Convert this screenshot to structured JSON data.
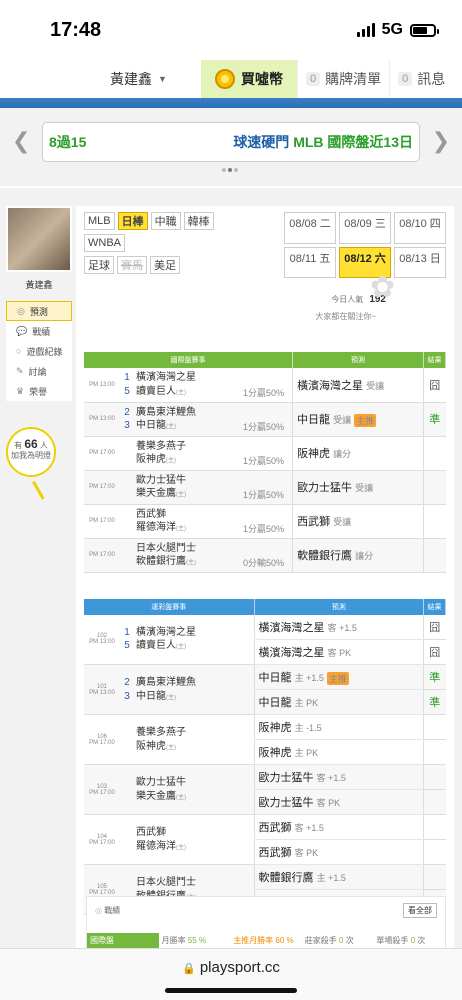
{
  "status": {
    "time": "17:48",
    "network": "5G"
  },
  "nav": {
    "user": "黃建鑫",
    "buy": "買噓幣",
    "cart_count": "0",
    "cart": "購牌清單",
    "msg_count": "0",
    "msg": "訊息"
  },
  "ticker": {
    "left": "8過15",
    "right_prefix": "球速硬門",
    "right_suffix": "MLB 國際盤近13日"
  },
  "sidebar": {
    "username": "黃建鑫",
    "items": [
      "預測",
      "戰績",
      "遊戲紀錄",
      "討論",
      "荣譽"
    ],
    "count_prefix": "有",
    "count": "66",
    "count_suffix": "人",
    "count_text": "加我為明燈"
  },
  "leagues": {
    "row1": [
      "MLB",
      "日棒",
      "中職",
      "韓棒"
    ],
    "row2": [
      "WNBA"
    ],
    "row3": [
      "足球",
      "賽馬",
      "美足"
    ]
  },
  "dates": [
    "08/08 二",
    "08/09 三",
    "08/10 四",
    "08/11 五",
    "08/12 六",
    "08/13 日"
  ],
  "popularity": {
    "label": "今日人氣",
    "value": "192",
    "note": "大家都在關注你~"
  },
  "intl": {
    "headers": [
      "國際盤賽事",
      "預測",
      "結果"
    ],
    "rows": [
      {
        "time": "PM 13:00",
        "n1": "1",
        "n2": "5",
        "t1": "橫濱海灣之星",
        "t2": "讀賣巨人",
        "odds": "1分贏50%",
        "pred": "橫濱海灣之星",
        "type": "受讓",
        "result": "囧",
        "tag": ""
      },
      {
        "time": "PM 13:00",
        "n1": "2",
        "n2": "3",
        "t1": "廣島東洋鯉魚",
        "t2": "中日龍",
        "odds": "1分贏50%",
        "pred": "中日龍",
        "type": "受讓",
        "result": "準",
        "tag": "主推"
      },
      {
        "time": "PM 17:00",
        "n1": "",
        "n2": "",
        "t1": "養樂多燕子",
        "t2": "阪神虎",
        "odds": "1分贏50%",
        "pred": "阪神虎",
        "type": "讓分",
        "result": "",
        "tag": ""
      },
      {
        "time": "PM 17:00",
        "n1": "",
        "n2": "",
        "t1": "歐力士猛牛",
        "t2": "樂天金鷹",
        "odds": "1分贏50%",
        "pred": "歐力士猛牛",
        "type": "受讓",
        "result": "",
        "tag": ""
      },
      {
        "time": "PM 17:00",
        "n1": "",
        "n2": "",
        "t1": "西武獅",
        "t2": "羅德海洋",
        "odds": "1分贏50%",
        "pred": "西武獅",
        "type": "受讓",
        "result": "",
        "tag": ""
      },
      {
        "time": "PM 17:00",
        "n1": "",
        "n2": "",
        "t1": "日本火腿鬥士",
        "t2": "軟體銀行鷹",
        "odds": "0分輸50%",
        "pred": "軟體銀行鷹",
        "type": "讓分",
        "result": "",
        "tag": ""
      }
    ]
  },
  "lottery": {
    "headers": [
      "運彩盤賽事",
      "預測",
      "結果"
    ],
    "rows": [
      {
        "id": "102",
        "time": "PM 13:00",
        "n1": "1",
        "n2": "5",
        "t1": "橫濱海灣之星",
        "t2": "讀賣巨人",
        "p1": "橫濱海灣之星",
        "p1t": "客 +1.5",
        "r1": "囧",
        "p2": "橫濱海灣之星",
        "p2t": "客 PK",
        "r2": "囧",
        "tag1": ""
      },
      {
        "id": "101",
        "time": "PM 13:00",
        "n1": "2",
        "n2": "3",
        "t1": "廣島東洋鯉魚",
        "t2": "中日龍",
        "p1": "中日龍",
        "p1t": "主 +1.5",
        "r1": "準",
        "p2": "中日龍",
        "p2t": "主 PK",
        "r2": "準",
        "tag1": "主推"
      },
      {
        "id": "106",
        "time": "PM 17:00",
        "n1": "",
        "n2": "",
        "t1": "養樂多燕子",
        "t2": "阪神虎",
        "p1": "阪神虎",
        "p1t": "主 -1.5",
        "r1": "",
        "p2": "阪神虎",
        "p2t": "主 PK",
        "r2": "",
        "tag1": ""
      },
      {
        "id": "103",
        "time": "PM 17:00",
        "n1": "",
        "n2": "",
        "t1": "歐力士猛牛",
        "t2": "樂天金鷹",
        "p1": "歐力士猛牛",
        "p1t": "客 +1.5",
        "r1": "",
        "p2": "歐力士猛牛",
        "p2t": "客 PK",
        "r2": "",
        "tag1": ""
      },
      {
        "id": "104",
        "time": "PM 17:00",
        "n1": "",
        "n2": "",
        "t1": "西武獅",
        "t2": "羅德海洋",
        "p1": "西武獅",
        "p1t": "客 +1.5",
        "r1": "",
        "p2": "西武獅",
        "p2t": "客 PK",
        "r2": "",
        "tag1": ""
      },
      {
        "id": "105",
        "time": "PM 17:00",
        "n1": "",
        "n2": "",
        "t1": "日本火腿鬥士",
        "t2": "軟體銀行鷹",
        "p1": "軟體銀行鷹",
        "p1t": "主 +1.5",
        "r1": "",
        "p2": "軟體銀行鷹",
        "p2t": "主 PK",
        "r2": "",
        "tag1": ""
      }
    ]
  },
  "record": {
    "title": "戰績",
    "view_all": "看全部",
    "tab": "國際盤",
    "month_label": "月勝率",
    "month_value": "55 %",
    "main_label": "主推月勝率",
    "main_value": "60 %",
    "streak_label": "莊家殺手",
    "streak_value": "0",
    "streak_unit": "次",
    "single_label": "單場殺手",
    "single_value": "0",
    "single_unit": "次"
  },
  "url": "playsport.cc"
}
